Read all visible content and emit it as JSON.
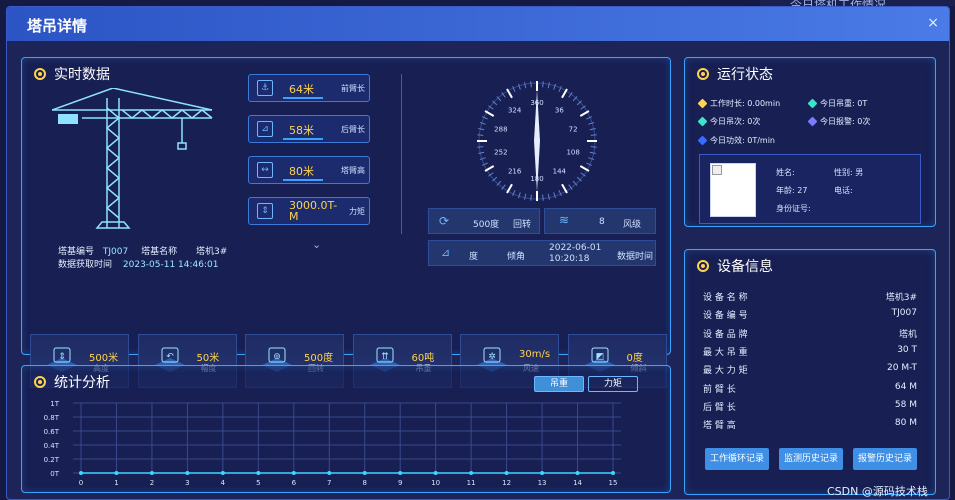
{
  "background": {
    "title": "今日塔机工作情况"
  },
  "modal": {
    "title": "塔吊详情",
    "close": "×"
  },
  "realtime": {
    "title": "实时数据",
    "stats": [
      {
        "value": "64米",
        "label": "前臂长",
        "icon": "hook-icon"
      },
      {
        "value": "58米",
        "label": "后臂长",
        "icon": "chart-icon"
      },
      {
        "value": "80米",
        "label": "塔臂高",
        "icon": "width-icon"
      },
      {
        "value": "3000.0T-M",
        "label": "力矩",
        "icon": "weight-icon"
      }
    ],
    "crane_info": {
      "code_label": "塔基编号",
      "code_value": "TJ007",
      "name_label": "塔基名称",
      "name_value": "塔机3#",
      "time_label": "数据获取时间",
      "time_value": "2023-05-11 14:46:01"
    },
    "expand": "⌄",
    "compass": {
      "labels": [
        "180",
        "216",
        "252",
        "288",
        "324",
        "360",
        "36",
        "72",
        "108",
        "144"
      ]
    },
    "mini": {
      "rotation_value": "500度",
      "rotation_label": "回转",
      "wind_value": "8",
      "wind_label": "风级",
      "tilt_value": "度",
      "tilt_label": "倾角",
      "date_value": "2022-06-01 10:20:18",
      "date_label": "数据时间"
    },
    "cards": [
      {
        "value": "500米",
        "label": "高度",
        "icon": "height-icon"
      },
      {
        "value": "50米",
        "label": "幅度",
        "icon": "range-icon"
      },
      {
        "value": "500度",
        "label": "回转",
        "icon": "rotate-icon"
      },
      {
        "value": "60吨",
        "label": "吊重",
        "icon": "lift-icon"
      },
      {
        "value": "30m/s",
        "label": "风速",
        "icon": "fan-icon"
      },
      {
        "value": "0度",
        "label": "倾斜",
        "icon": "tilt-icon"
      }
    ]
  },
  "status": {
    "title": "运行状态",
    "items": [
      {
        "text": "工作时长: 0.00min",
        "color": "#ffd34d"
      },
      {
        "text": "今日吊重: 0T",
        "color": "#38e6c8"
      },
      {
        "text": "今日吊次: 0次",
        "color": "#38e6c8"
      },
      {
        "text": "今日报警: 0次",
        "color": "#7b7bff"
      },
      {
        "text": "今日功效: 0T/min",
        "color": "#3a6bff"
      }
    ],
    "person": {
      "name": "姓名:",
      "gender": "性别: 男",
      "age": "年龄: 27",
      "phone": "电话:",
      "id": "身份证号:"
    }
  },
  "device": {
    "title": "设备信息",
    "rows": [
      {
        "label": "设 备 名 称",
        "value": "塔机3#"
      },
      {
        "label": "设 备 编 号",
        "value": "TJ007"
      },
      {
        "label": "设 备 品 牌",
        "value": "塔机"
      },
      {
        "label": "最 大 吊 重",
        "value": "30 T"
      },
      {
        "label": "最 大 力 矩",
        "value": "20 M-T"
      },
      {
        "label": "前 臂 长",
        "value": "64 M"
      },
      {
        "label": "后 臂 长",
        "value": "58 M"
      },
      {
        "label": "塔 臂 高",
        "value": "80 M"
      }
    ],
    "buttons": [
      "工作循环记录",
      "监测历史记录",
      "报警历史记录"
    ]
  },
  "stats": {
    "title": "统计分析",
    "tabs": [
      "吊重",
      "力矩"
    ],
    "chart_data": {
      "type": "line",
      "x": [
        0,
        1,
        2,
        3,
        4,
        5,
        6,
        7,
        8,
        9,
        10,
        11,
        12,
        13,
        14,
        15
      ],
      "values": [
        0,
        0,
        0,
        0,
        0,
        0,
        0,
        0,
        0,
        0,
        0,
        0,
        0,
        0,
        0,
        0
      ],
      "yticks": [
        "1T",
        "0.8T",
        "0.6T",
        "0.4T",
        "0.2T",
        "0T"
      ],
      "ylim": [
        0,
        1
      ],
      "color": "#38d9ff"
    }
  },
  "watermark": "CSDN @源码技术栈"
}
